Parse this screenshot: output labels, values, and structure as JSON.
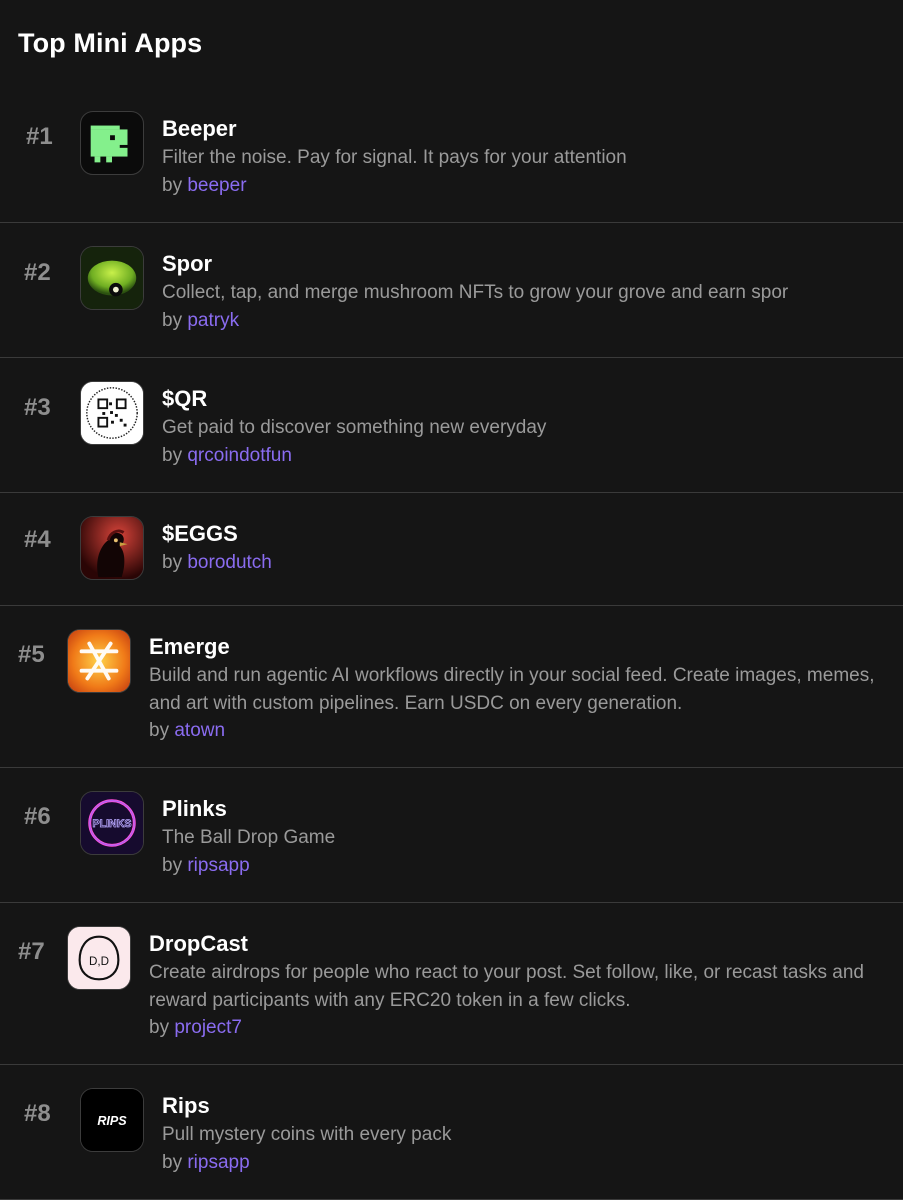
{
  "title": "Top Mini Apps",
  "by_label": "by",
  "apps": [
    {
      "rank": "#1",
      "name": "Beeper",
      "description": "Filter the noise. Pay for signal. It pays for your attention",
      "author": "beeper",
      "icon": "beeper-dino-icon"
    },
    {
      "rank": "#2",
      "name": "Spor",
      "description": "Collect, tap, and merge mushroom NFTs to grow your grove and earn spor",
      "author": "patryk",
      "icon": "mushroom-icon"
    },
    {
      "rank": "#3",
      "name": "$QR",
      "description": "Get paid to discover something new everyday",
      "author": "qrcoindotfun",
      "icon": "qr-code-icon"
    },
    {
      "rank": "#4",
      "name": "$EGGS",
      "description": "",
      "author": "borodutch",
      "icon": "rooster-icon"
    },
    {
      "rank": "#5",
      "name": "Emerge",
      "description": "Build and run agentic AI workflows directly in your social feed. Create images, memes, and art with custom pipelines. Earn USDC on every generation.",
      "author": "atown",
      "icon": "emerge-star-icon"
    },
    {
      "rank": "#6",
      "name": "Plinks",
      "description": "The Ball Drop Game",
      "author": "ripsapp",
      "icon": "plinks-icon"
    },
    {
      "rank": "#7",
      "name": "DropCast",
      "description": "Create airdrops for people who react to your post. Set follow, like, or recast tasks and reward participants with any ERC20 token in a few clicks.",
      "author": "project7",
      "icon": "dropcast-face-icon"
    },
    {
      "rank": "#8",
      "name": "Rips",
      "description": "Pull mystery coins with every pack",
      "author": "ripsapp",
      "icon": "rips-logo-icon"
    }
  ],
  "icon_text": {
    "plinks": "PLINKS",
    "dropcast": "D,D",
    "rips": "RIPS"
  }
}
